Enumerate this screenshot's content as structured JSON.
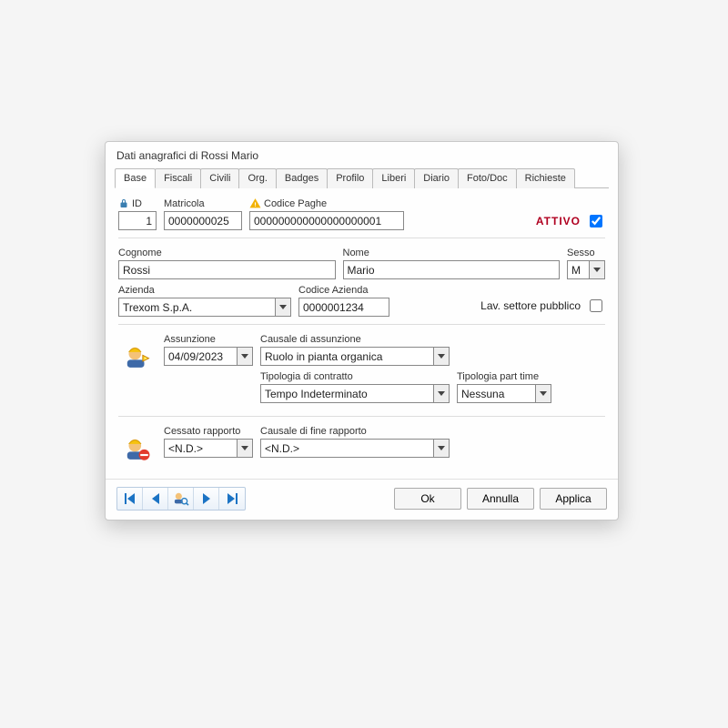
{
  "window": {
    "title": "Dati anagrafici di Rossi Mario"
  },
  "tabs": [
    {
      "label": "Base",
      "active": true
    },
    {
      "label": "Fiscali"
    },
    {
      "label": "Civili"
    },
    {
      "label": "Org."
    },
    {
      "label": "Badges"
    },
    {
      "label": "Profilo"
    },
    {
      "label": "Liberi"
    },
    {
      "label": "Diario"
    },
    {
      "label": "Foto/Doc"
    },
    {
      "label": "Richieste"
    }
  ],
  "header": {
    "id_label": "ID",
    "id_value": "1",
    "matricola_label": "Matricola",
    "matricola_value": "0000000025",
    "codice_paghe_label": "Codice Paghe",
    "codice_paghe_value": "000000000000000000001",
    "status_label": "ATTIVO",
    "status_checked": true
  },
  "identity": {
    "cognome_label": "Cognome",
    "cognome_value": "Rossi",
    "nome_label": "Nome",
    "nome_value": "Mario",
    "sesso_label": "Sesso",
    "sesso_value": "M"
  },
  "company": {
    "azienda_label": "Azienda",
    "azienda_value": "Trexom S.p.A.",
    "codice_azienda_label": "Codice Azienda",
    "codice_azienda_value": "0000001234",
    "settore_pubblico_label": "Lav. settore pubblico",
    "settore_pubblico_checked": false
  },
  "hiring": {
    "assunzione_label": "Assunzione",
    "assunzione_value": "04/09/2023",
    "causale_assunzione_label": "Causale di assunzione",
    "causale_assunzione_value": "Ruolo in pianta organica",
    "tipologia_contratto_label": "Tipologia di contratto",
    "tipologia_contratto_value": "Tempo Indeterminato",
    "tipologia_parttime_label": "Tipologia part time",
    "tipologia_parttime_value": "Nessuna"
  },
  "termination": {
    "cessato_label": "Cessato rapporto",
    "cessato_value": "<N.D.>",
    "causale_fine_label": "Causale di fine rapporto",
    "causale_fine_value": "<N.D.>"
  },
  "buttons": {
    "ok": "Ok",
    "annulla": "Annulla",
    "applica": "Applica"
  },
  "colors": {
    "status_red": "#b00020",
    "yellow_field": "#fff59a",
    "teal_field": "#0d8f8f"
  }
}
